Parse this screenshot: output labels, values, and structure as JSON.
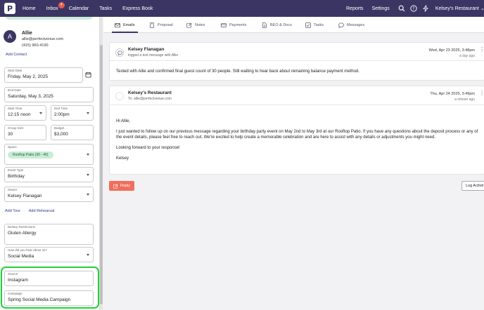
{
  "nav": {
    "logo": "P",
    "items": [
      {
        "label": "Home"
      },
      {
        "label": "Inbox",
        "badge": "4"
      },
      {
        "label": "Calendar"
      },
      {
        "label": "Tasks"
      },
      {
        "label": "Express Book"
      }
    ],
    "right_items": [
      {
        "label": "Reports"
      },
      {
        "label": "Settings"
      }
    ],
    "restaurant": "Kelsey's Restaurant",
    "icons": [
      "search-icon",
      "help-icon",
      "bolt-icon"
    ]
  },
  "sidebar": {
    "contact": {
      "initial": "A",
      "name": "Allie",
      "email": "allie@perfectvenue.com",
      "phone": "(415) 960-4190"
    },
    "add_contact": "Add Contact",
    "fields": {
      "start_date": {
        "label": "Start Date",
        "value": "Friday, May 2, 2025"
      },
      "end_date": {
        "label": "End Date",
        "value": "Saturday, May 3, 2025"
      },
      "start_time": {
        "label": "Start Time",
        "value": "12:15 noon"
      },
      "end_time": {
        "label": "End Time",
        "value": "2:00pm"
      },
      "group_size": {
        "label": "Group Size",
        "value": "30"
      },
      "budget": {
        "label": "Budget",
        "value": "$3,000"
      },
      "space": {
        "label": "Space",
        "value": "Rooftop Patio (30 - 40)"
      },
      "event_type": {
        "label": "Event Type",
        "value": "Birthday"
      },
      "owner": {
        "label": "Owner",
        "value": "Kelsey Flanagan"
      },
      "dietary": {
        "label": "Dietary Restrictions",
        "value": "Gluten Allergy"
      },
      "heard_about": {
        "label": "How did you hear about us?",
        "value": "Social Media"
      },
      "source": {
        "label": "Source",
        "value": "Instagram"
      },
      "campaign": {
        "label": "Campaign",
        "value": "Spring Social Media Campaign"
      }
    },
    "add_tour": "Add Tour",
    "add_rehearsal": "Add Rehearsal"
  },
  "tabs": [
    {
      "label": "Emails",
      "icon": "mail-icon",
      "active": true
    },
    {
      "label": "Proposal",
      "icon": "document-icon"
    },
    {
      "label": "Notes",
      "icon": "edit-icon"
    },
    {
      "label": "Payments",
      "icon": "card-icon"
    },
    {
      "label": "BEO & Docs",
      "icon": "file-icon"
    },
    {
      "label": "Tasks",
      "icon": "check-icon"
    },
    {
      "label": "Messages",
      "icon": "chat-icon"
    }
  ],
  "messages": [
    {
      "sender": "Kelsey Flanagan",
      "sub": "logged a text message with Allie",
      "date": "Wed, Apr 23 2025, 3:48pm",
      "ago": "a day ago",
      "body": [
        "Texted with Allie and confirmed final guest count of 30 people. Still waiting to hear back about remaining balance payment method."
      ]
    },
    {
      "sender": "Kelsey's Restaurant",
      "sub": "To: allie@perfectvenue.com",
      "date": "Thu, Apr 24 2025, 3:49pm",
      "ago": "a minute ago",
      "body": [
        "Hi Allie,",
        "I just wanted to follow up on our previous message regarding your birthday party event on May 2nd to May 3rd at our Rooftop Patio. If you have any questions about the deposit process or any of the event details, please feel free to reach out. We're excited to help create a memorable celebration and are here to assist with any details or adjustments you might need.",
        "Looking forward to your response!",
        "Kelsey"
      ]
    }
  ],
  "actions": {
    "reply": "Reply",
    "log_activity": "Log Activit"
  },
  "colors": {
    "nav": "#3b3564",
    "accent": "#f26d5b",
    "highlight": "#22d03a",
    "chip": "#c9ecd7"
  }
}
